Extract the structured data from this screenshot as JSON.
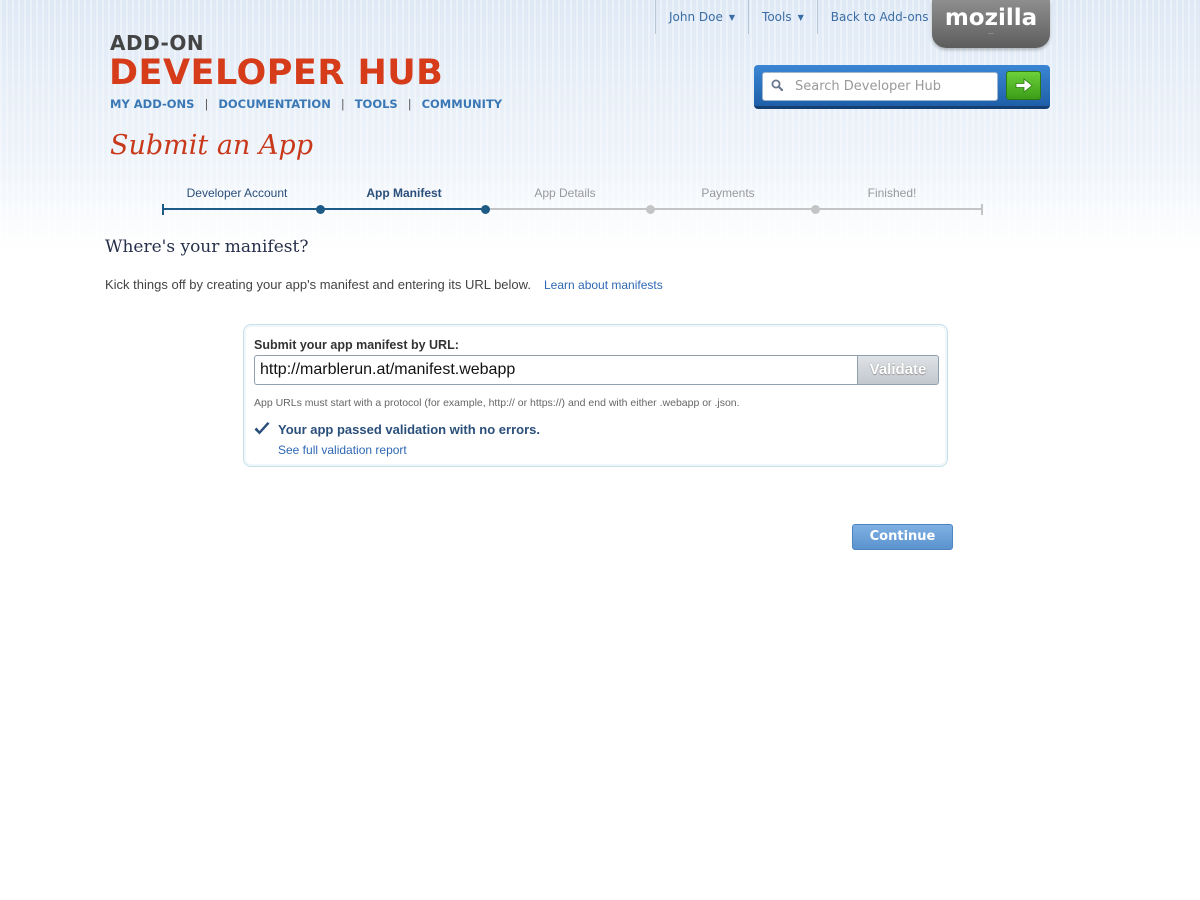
{
  "header": {
    "top_nav": [
      {
        "label": "John Doe",
        "has_menu": true
      },
      {
        "label": "Tools",
        "has_menu": true
      },
      {
        "label": "Back to Add-ons",
        "has_menu": false
      }
    ],
    "mozilla_label": "mozilla",
    "logo_small": "ADD-ON",
    "logo_big": "DEVELOPER HUB",
    "main_nav": [
      "MY ADD-ONS",
      "DOCUMENTATION",
      "TOOLS",
      "COMMUNITY"
    ],
    "search": {
      "placeholder": "Search Developer Hub",
      "icon": "search-icon",
      "go_icon": "arrow-right-icon"
    }
  },
  "page_title": "Submit an App",
  "steps": [
    {
      "label": "Developer Account",
      "state": "done"
    },
    {
      "label": "App Manifest",
      "state": "current"
    },
    {
      "label": "App Details",
      "state": "todo"
    },
    {
      "label": "Payments",
      "state": "todo"
    },
    {
      "label": "Finished!",
      "state": "todo"
    }
  ],
  "manifest": {
    "heading": "Where's your manifest?",
    "intro": "Kick things off by creating your app's manifest and entering its URL below.",
    "intro_link": "Learn about manifests",
    "form_label": "Submit your app manifest by URL:",
    "url_value": "http://marblerun.at/manifest.webapp",
    "validate_label": "Validate",
    "hint": "App URLs must start with a protocol (for example, http:// or https://) and end with either .webapp or .json.",
    "success_message": "Your app passed validation with no errors.",
    "report_link": "See full validation report"
  },
  "continue_label": "Continue",
  "colors": {
    "brand_red": "#d63b1a",
    "link_blue": "#2f68b4",
    "step_done": "#1e5a86",
    "step_todo": "#c4c4c4",
    "go_green": "#4cb020"
  }
}
